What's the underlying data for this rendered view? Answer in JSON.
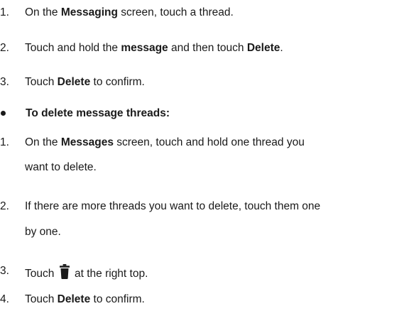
{
  "steps_a": [
    {
      "num": "1.",
      "pre": "On the ",
      "bold": "Messaging",
      "post": " screen, touch a thread."
    },
    {
      "num": "2.",
      "pre": "Touch and hold the ",
      "bold": "message",
      "mid": " and then touch ",
      "bold2": "Delete",
      "post": "."
    },
    {
      "num": "3.",
      "pre": "Touch ",
      "bold": "Delete",
      "post": " to confirm."
    }
  ],
  "bullet": {
    "label": "To delete message threads:"
  },
  "steps_b": [
    {
      "num": "1.",
      "pre": "On the ",
      "bold": "Messages",
      "post": " screen, touch and hold one thread you",
      "cont": "want to delete."
    },
    {
      "num": "2.",
      "pre": "If there are more threads you want to delete, touch them one",
      "cont": "by one."
    },
    {
      "num": "3.",
      "pre": "Touch",
      "post": "at the right top.",
      "icon": "trash-icon"
    },
    {
      "num": "4.",
      "pre": "Touch ",
      "bold": "Delete",
      "post": " to confirm."
    }
  ]
}
